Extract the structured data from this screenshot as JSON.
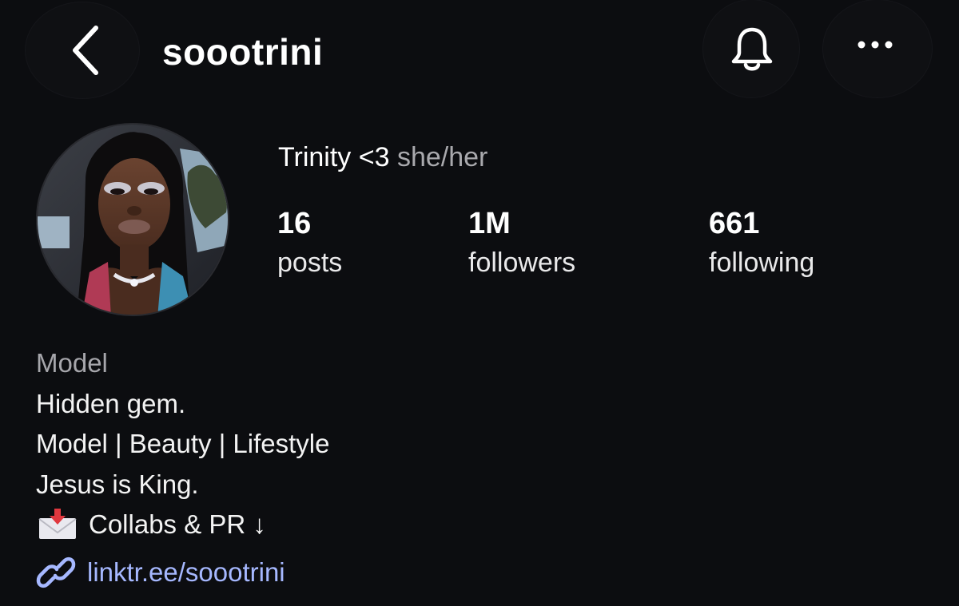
{
  "header": {
    "username": "soootrini",
    "back_icon": "chevron-left-icon",
    "bell_icon": "bell-icon",
    "more_icon": "more-horizontal-icon"
  },
  "profile": {
    "display_name": "Trinity <3",
    "pronouns": "she/her",
    "stats": [
      {
        "value": "16",
        "label": "posts"
      },
      {
        "value": "1M",
        "label": "followers"
      },
      {
        "value": "661",
        "label": "following"
      }
    ]
  },
  "bio": {
    "category": "Model",
    "lines": [
      "Hidden gem.",
      "Model | Beauty | Lifestyle",
      "Jesus is King."
    ],
    "collab_line": "Collabs & PR ↓",
    "collab_icon": "envelope-with-arrow-icon",
    "link_text": "linktr.ee/soootrini",
    "link_icon": "link-icon"
  },
  "colors": {
    "background": "#0c0d10",
    "text_primary": "#ffffff",
    "text_secondary": "#a6a6ab",
    "link": "#a6b8ff"
  }
}
